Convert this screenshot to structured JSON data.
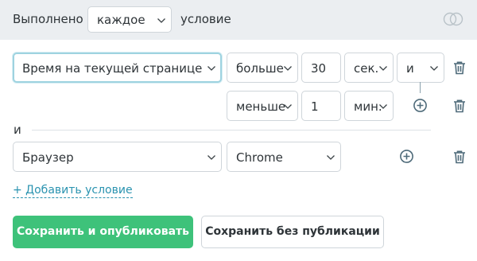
{
  "header": {
    "prefix": "Выполнено",
    "mode": "каждое",
    "suffix": "условие"
  },
  "group1": {
    "row1": {
      "field": "Время на текущей странице",
      "operator": "больше",
      "value": "30",
      "unit": "сек.",
      "join": "и"
    },
    "row2": {
      "operator": "меньше",
      "value": "1",
      "unit": "мин."
    }
  },
  "separator": {
    "label": "и"
  },
  "group2": {
    "row1": {
      "field": "Браузер",
      "value": "Chrome"
    }
  },
  "add_condition": "+ Добавить условие",
  "buttons": {
    "save_publish": "Сохранить и опубликовать",
    "save_draft": "Сохранить без публикации"
  },
  "colors": {
    "accent": "#2a93b0",
    "primary_button": "#3ec27a",
    "icon": "#4f6b7a",
    "header_bg": "#ebeef1"
  }
}
